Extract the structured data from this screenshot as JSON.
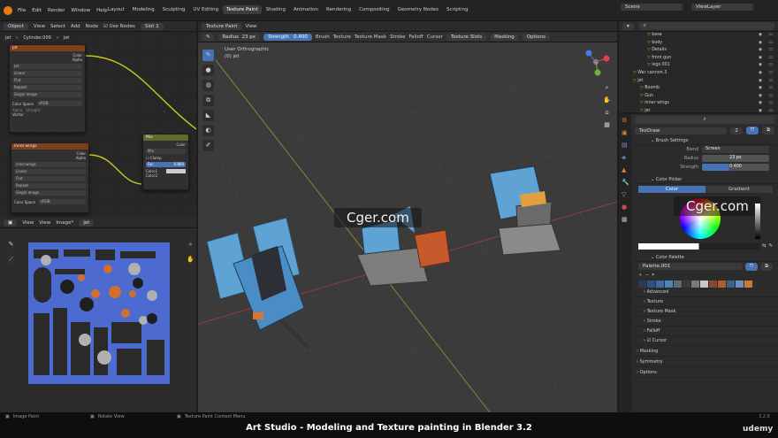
{
  "menu": [
    "File",
    "Edit",
    "Render",
    "Window",
    "Help"
  ],
  "workspaces": [
    "Layout",
    "Modeling",
    "Sculpting",
    "UV Editing",
    "Texture Paint",
    "Shading",
    "Animation",
    "Rendering",
    "Compositing",
    "Geometry Nodes",
    "Scripting"
  ],
  "active_workspace": "Texture Paint",
  "scene": {
    "scene_name": "Scene",
    "view_layer": "ViewLayer"
  },
  "node_header": {
    "mode": "Object",
    "items": [
      "View",
      "Select",
      "Add",
      "Node"
    ],
    "use_nodes": "Use Nodes",
    "slot": "Slot 1"
  },
  "node_breadcrumb": [
    "jet",
    "Cylinder.009",
    "jet"
  ],
  "node1": {
    "title": "jet",
    "out_color": "Color",
    "out_alpha": "Alpha",
    "image": "jet",
    "interp": "Linear",
    "proj": "Flat",
    "ext": "Repeat",
    "src": "Single Image",
    "cs_label": "Color Space",
    "cs_value": "sRGB",
    "alpha_label": "Alpha",
    "alpha_value": "Straight",
    "vector": "Vector"
  },
  "node2": {
    "title": "inner.wings",
    "out_color": "Color",
    "out_alpha": "Alpha",
    "image": "inner.wings",
    "interp": "Linear",
    "proj": "Flat",
    "ext": "Repeat",
    "src": "Single Image",
    "cs_label": "Color Space",
    "cs_value": "sRGB"
  },
  "node3": {
    "title": "Mix",
    "out": "Color",
    "blend": "Mix",
    "clamp": "Clamp",
    "fac": "Fac",
    "fac_val": "0.800",
    "c1": "Color1",
    "c2": "Color2"
  },
  "image_header": {
    "items": [
      "View",
      "View",
      "Image*"
    ],
    "image": "jet"
  },
  "viewport_header": {
    "mode": "Texture Paint",
    "view": "View",
    "radius_label": "Radius",
    "radius": "23 px",
    "strength_label": "Strength",
    "strength": "0.400",
    "menus": [
      "Brush",
      "Texture",
      "Texture Mask",
      "Stroke",
      "Falloff",
      "Cursor"
    ],
    "slots": "Texture Slots",
    "masking": "Masking",
    "options": "Options"
  },
  "viewport_info": {
    "line1": "User Orthographic",
    "line2": "(0) jet"
  },
  "outliner": [
    {
      "name": "base",
      "indent": 3
    },
    {
      "name": "body",
      "indent": 3
    },
    {
      "name": "Details",
      "indent": 3
    },
    {
      "name": "front gun",
      "indent": 3
    },
    {
      "name": "legs.001",
      "indent": 3
    },
    {
      "name": "War cannon.3",
      "indent": 1
    },
    {
      "name": "jet",
      "indent": 1
    },
    {
      "name": "Boomb",
      "indent": 2
    },
    {
      "name": "Gun",
      "indent": 2
    },
    {
      "name": "inner wings",
      "indent": 2
    },
    {
      "name": "jet",
      "indent": 2
    }
  ],
  "props": {
    "brush_name": "TexDraw",
    "brush_users": "2",
    "brush_settings": "Brush Settings",
    "blend_label": "Blend",
    "blend": "Screen",
    "radius_label": "Radius",
    "radius": "23 px",
    "strength_label": "Strength",
    "strength": "0.400",
    "color_picker": "Color Picker",
    "tab_color": "Color",
    "tab_gradient": "Gradient",
    "color_palette": "Color Palette",
    "palette_name": "Palette.001",
    "palette_colors": [
      "#2a3a56",
      "#2f4f80",
      "#3d6ca3",
      "#4f84bb",
      "#5b6a7d",
      "#3a3a3a",
      "#7a7a7a",
      "#c8c8c8",
      "#8a4a2a",
      "#b35d2f",
      "#3e5f8a",
      "#6d90b8",
      "#cc7a36",
      "#2c2c2c"
    ],
    "subsections": [
      "Advanced",
      "Texture",
      "Texture Mask",
      "Stroke",
      "Falloff",
      "Cursor"
    ],
    "cursor_checked": true,
    "sections": [
      "Masking",
      "Symmetry",
      "Options"
    ]
  },
  "status": {
    "left": "Image Paint",
    "middle": "Rotate View",
    "right": "Texture Paint Context Menu",
    "version": "3.2.0"
  },
  "caption": "Art Studio - Modeling and Texture painting in Blender 3.2",
  "brand": "udemy",
  "watermark": "Cger.com"
}
